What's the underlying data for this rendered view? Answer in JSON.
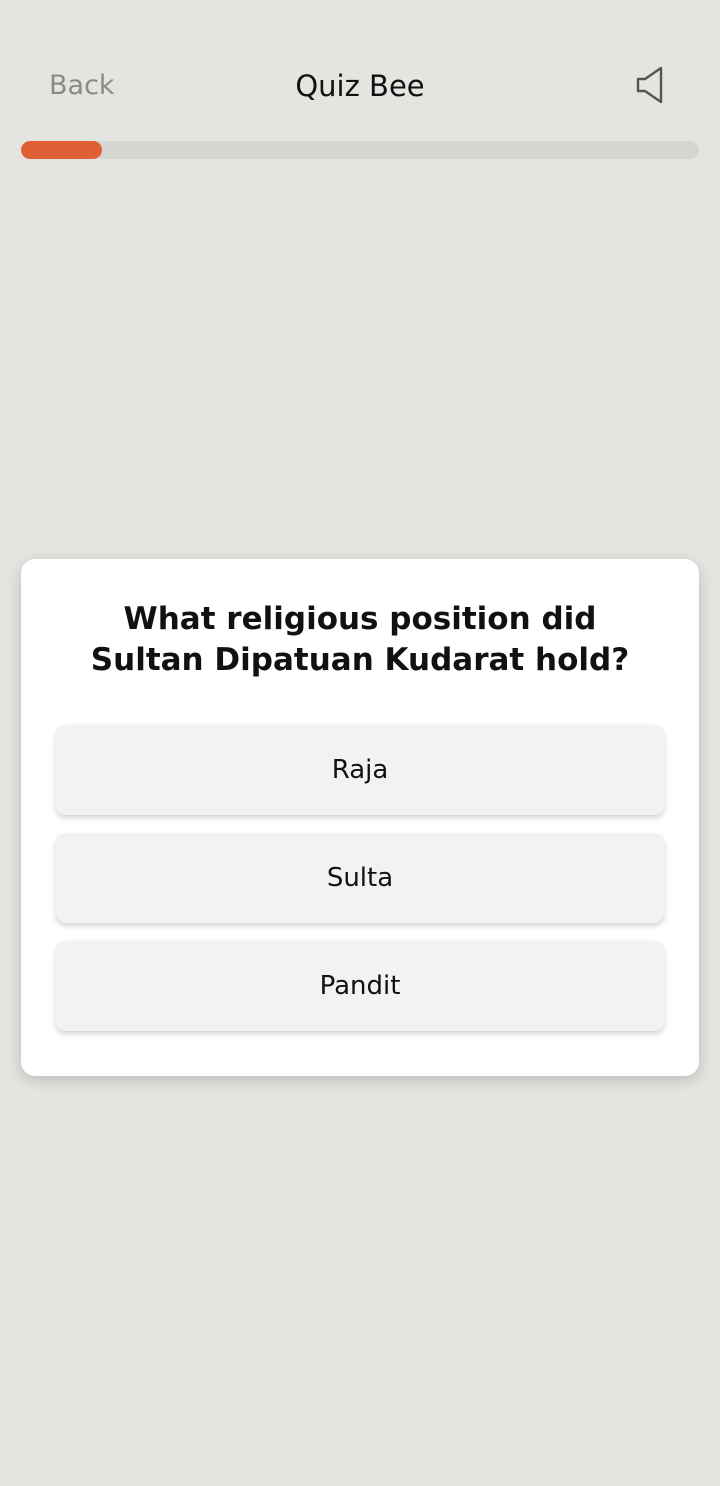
{
  "header": {
    "back_label": "Back",
    "title": "Quiz Bee",
    "sound_icon": "speaker-icon"
  },
  "progress": {
    "fraction": 0.12,
    "fill_color": "#e06035",
    "track_color": "#d5d5d2"
  },
  "quiz": {
    "question": "What religious position did Sultan Dipatuan Kudarat hold?",
    "options": [
      {
        "label": "Raja"
      },
      {
        "label": "Sulta"
      },
      {
        "label": "Pandit"
      }
    ]
  }
}
